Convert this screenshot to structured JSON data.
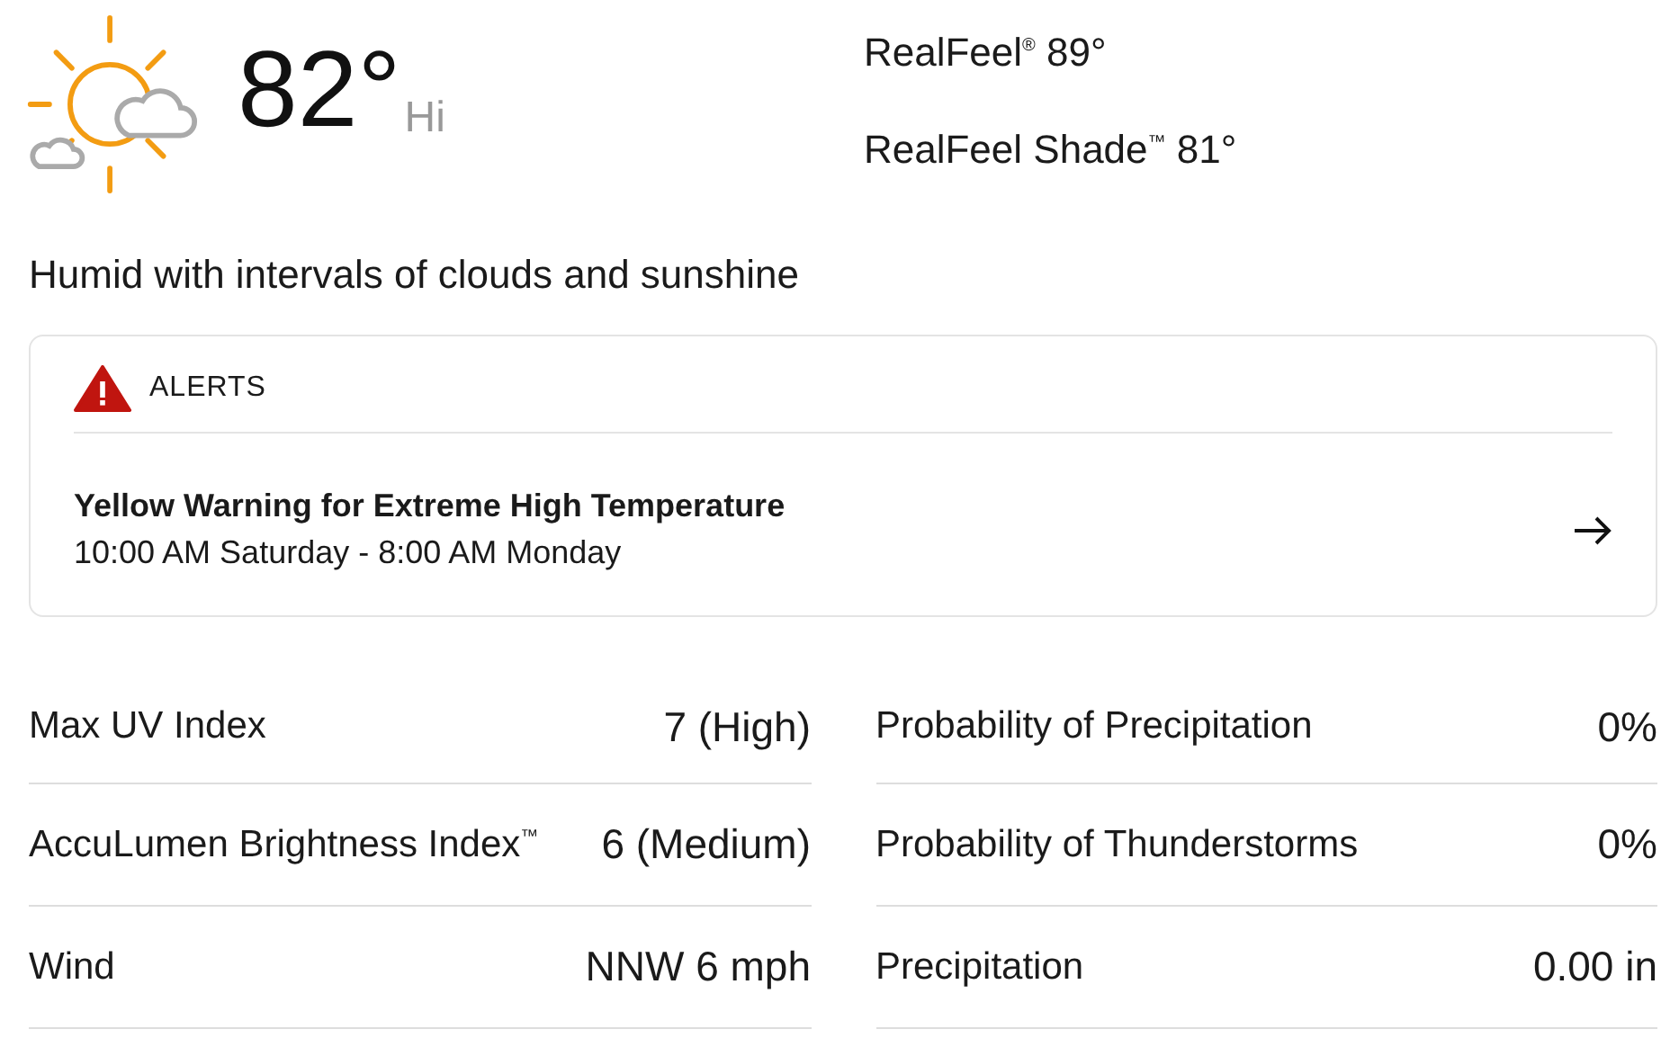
{
  "current": {
    "temperature": "82°",
    "label": "Hi"
  },
  "realfeel": [
    "RealFeel$^{®}$ 89°",
    "RealFeel Shade$^{™}$ 81°"
  ],
  "phrase": "Humid with intervals of clouds and sunshine",
  "alerts": {
    "heading": "ALERTS",
    "items": [
      {
        "title": "Yellow Warning for Extreme High Temperature",
        "time": "10:00 AM Saturday - 8:00 AM Monday"
      }
    ]
  },
  "details": [
    [
      {
        "label": "Max UV Index",
        "value": "7 (High)"
      },
      {
        "label": "AccuLumen Brightness Index$^{™}$",
        "value": "6 (Medium)"
      },
      {
        "label": "Wind",
        "value": "NNW 6 mph"
      }
    ],
    [
      {
        "label": "Probability of Precipitation",
        "value": "0%"
      },
      {
        "label": "Probability of Thunderstorms",
        "value": "0%"
      },
      {
        "label": "Precipitation",
        "value": "0.00 in"
      }
    ]
  ]
}
